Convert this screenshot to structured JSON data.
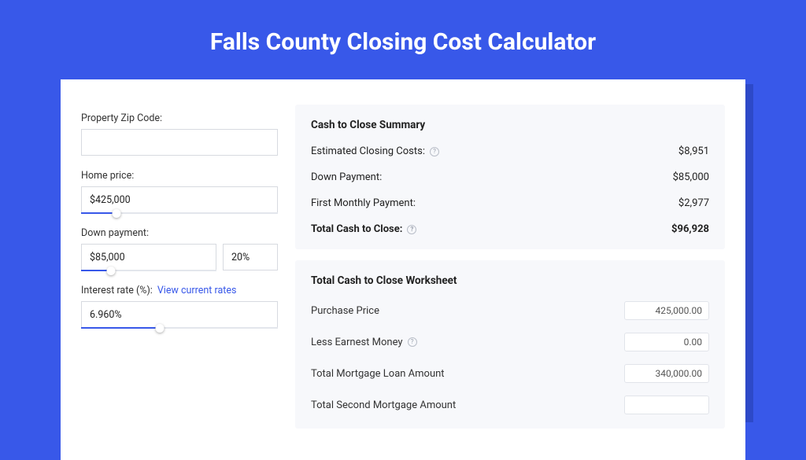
{
  "title": "Falls County Closing Cost Calculator",
  "left": {
    "zip_label": "Property Zip Code:",
    "zip_value": "",
    "home_price_label": "Home price:",
    "home_price_value": "$425,000",
    "home_price_fill_pct": 18,
    "down_label": "Down payment:",
    "down_value": "$85,000",
    "down_fill_pct": 22,
    "down_pct_value": "20%",
    "rate_label": "Interest rate (%):",
    "rate_link": "View current rates",
    "rate_value": "6.960%",
    "rate_fill_pct": 40
  },
  "summary": {
    "heading": "Cash to Close Summary",
    "rows": [
      {
        "label": "Estimated Closing Costs:",
        "help": true,
        "value": "$8,951",
        "bold": false
      },
      {
        "label": "Down Payment:",
        "help": false,
        "value": "$85,000",
        "bold": false
      },
      {
        "label": "First Monthly Payment:",
        "help": false,
        "value": "$2,977",
        "bold": false
      },
      {
        "label": "Total Cash to Close:",
        "help": true,
        "value": "$96,928",
        "bold": true
      }
    ]
  },
  "worksheet": {
    "heading": "Total Cash to Close Worksheet",
    "rows": [
      {
        "label": "Purchase Price",
        "help": false,
        "value": "425,000.00"
      },
      {
        "label": "Less Earnest Money",
        "help": true,
        "value": "0.00"
      },
      {
        "label": "Total Mortgage Loan Amount",
        "help": false,
        "value": "340,000.00"
      },
      {
        "label": "Total Second Mortgage Amount",
        "help": false,
        "value": ""
      }
    ]
  }
}
